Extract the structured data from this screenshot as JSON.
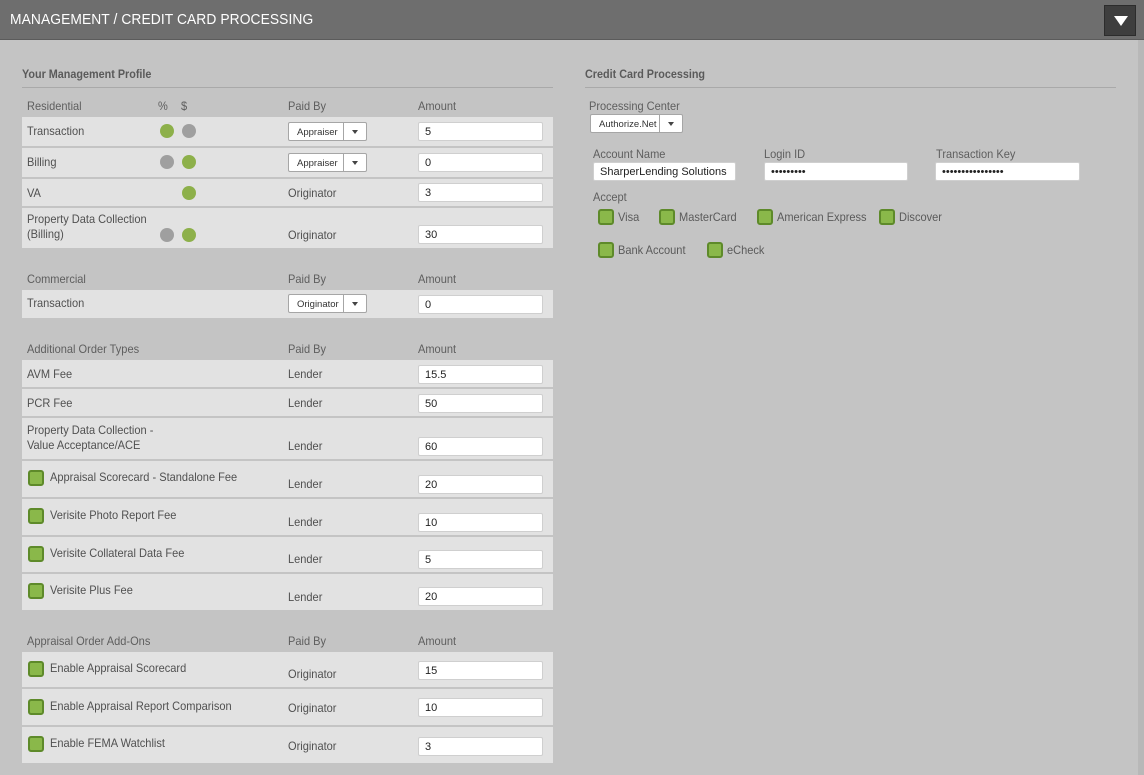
{
  "header": {
    "title": "MANAGEMENT / CREDIT CARD PROCESSING",
    "menu_icon": "chevron-down-icon"
  },
  "left": {
    "section_title": "Your Management Profile",
    "residential": {
      "headers": {
        "category": "Residential",
        "pct": "%",
        "dollar": "$",
        "paid_by": "Paid By",
        "amount": "Amount"
      },
      "rows": [
        {
          "label": "Transaction",
          "pct": true,
          "dollar": false,
          "paid_by": "Appraiser",
          "paid_by_type": "select",
          "amount": "5"
        },
        {
          "label": "Billing",
          "pct": false,
          "dollar": true,
          "paid_by": "Appraiser",
          "paid_by_type": "select",
          "amount": "0"
        },
        {
          "label": "VA",
          "pct": null,
          "dollar": true,
          "paid_by": "Originator",
          "paid_by_type": "text",
          "amount": "3"
        },
        {
          "label": "Property Data Collection",
          "label2": "(Billing)",
          "pct": false,
          "dollar": true,
          "paid_by": "Originator",
          "paid_by_type": "text",
          "amount": "30"
        }
      ]
    },
    "commercial": {
      "headers": {
        "category": "Commercial",
        "paid_by": "Paid By",
        "amount": "Amount"
      },
      "rows": [
        {
          "label": "Transaction",
          "paid_by": "Originator",
          "amount": "0"
        }
      ]
    },
    "additional": {
      "headers": {
        "category": "Additional Order Types",
        "paid_by": "Paid By",
        "amount": "Amount"
      },
      "rows": [
        {
          "label": "AVM Fee",
          "paid_by": "Lender",
          "amount": "15.5"
        },
        {
          "label": "PCR Fee",
          "paid_by": "Lender",
          "amount": "50"
        },
        {
          "label": "Property Data Collection -",
          "label2": "Value Acceptance/ACE",
          "paid_by": "Lender",
          "amount": "60"
        },
        {
          "label": "Appraisal Scorecard - Standalone Fee",
          "checked": true,
          "paid_by": "Lender",
          "amount": "20"
        },
        {
          "label": "Verisite Photo Report Fee",
          "checked": true,
          "paid_by": "Lender",
          "amount": "10"
        },
        {
          "label": "Verisite Collateral Data Fee",
          "checked": true,
          "paid_by": "Lender",
          "amount": "5"
        },
        {
          "label": "Verisite Plus Fee",
          "checked": true,
          "paid_by": "Lender",
          "amount": "20"
        }
      ]
    },
    "addons": {
      "headers": {
        "category": "Appraisal Order Add-Ons",
        "paid_by": "Paid By",
        "amount": "Amount"
      },
      "rows": [
        {
          "label": "Enable Appraisal Scorecard",
          "checked": true,
          "paid_by": "Originator",
          "amount": "15"
        },
        {
          "label": "Enable Appraisal Report Comparison",
          "checked": true,
          "paid_by": "Originator",
          "amount": "10"
        },
        {
          "label": "Enable FEMA Watchlist",
          "checked": true,
          "paid_by": "Originator",
          "amount": "3"
        }
      ]
    }
  },
  "right": {
    "section_title": "Credit Card Processing",
    "processing_center": {
      "label": "Processing Center",
      "value": "Authorize.Net"
    },
    "account_name": {
      "label": "Account Name",
      "value": "SharperLending Solutions"
    },
    "login_id": {
      "label": "Login ID",
      "value": "•••••••••"
    },
    "transaction_key": {
      "label": "Transaction Key",
      "value": "••••••••••••••••"
    },
    "accept": {
      "label": "Accept",
      "items": [
        "Visa",
        "MasterCard",
        "American Express",
        "Discover",
        "Bank Account",
        "eCheck"
      ]
    }
  },
  "colors": {
    "header_bg": "#6e6e6e",
    "page_bg": "#c4c4c4",
    "row_bg": "#e2e2e2",
    "accent_green": "#8ab84a",
    "dot_off": "#9f9f9f"
  }
}
